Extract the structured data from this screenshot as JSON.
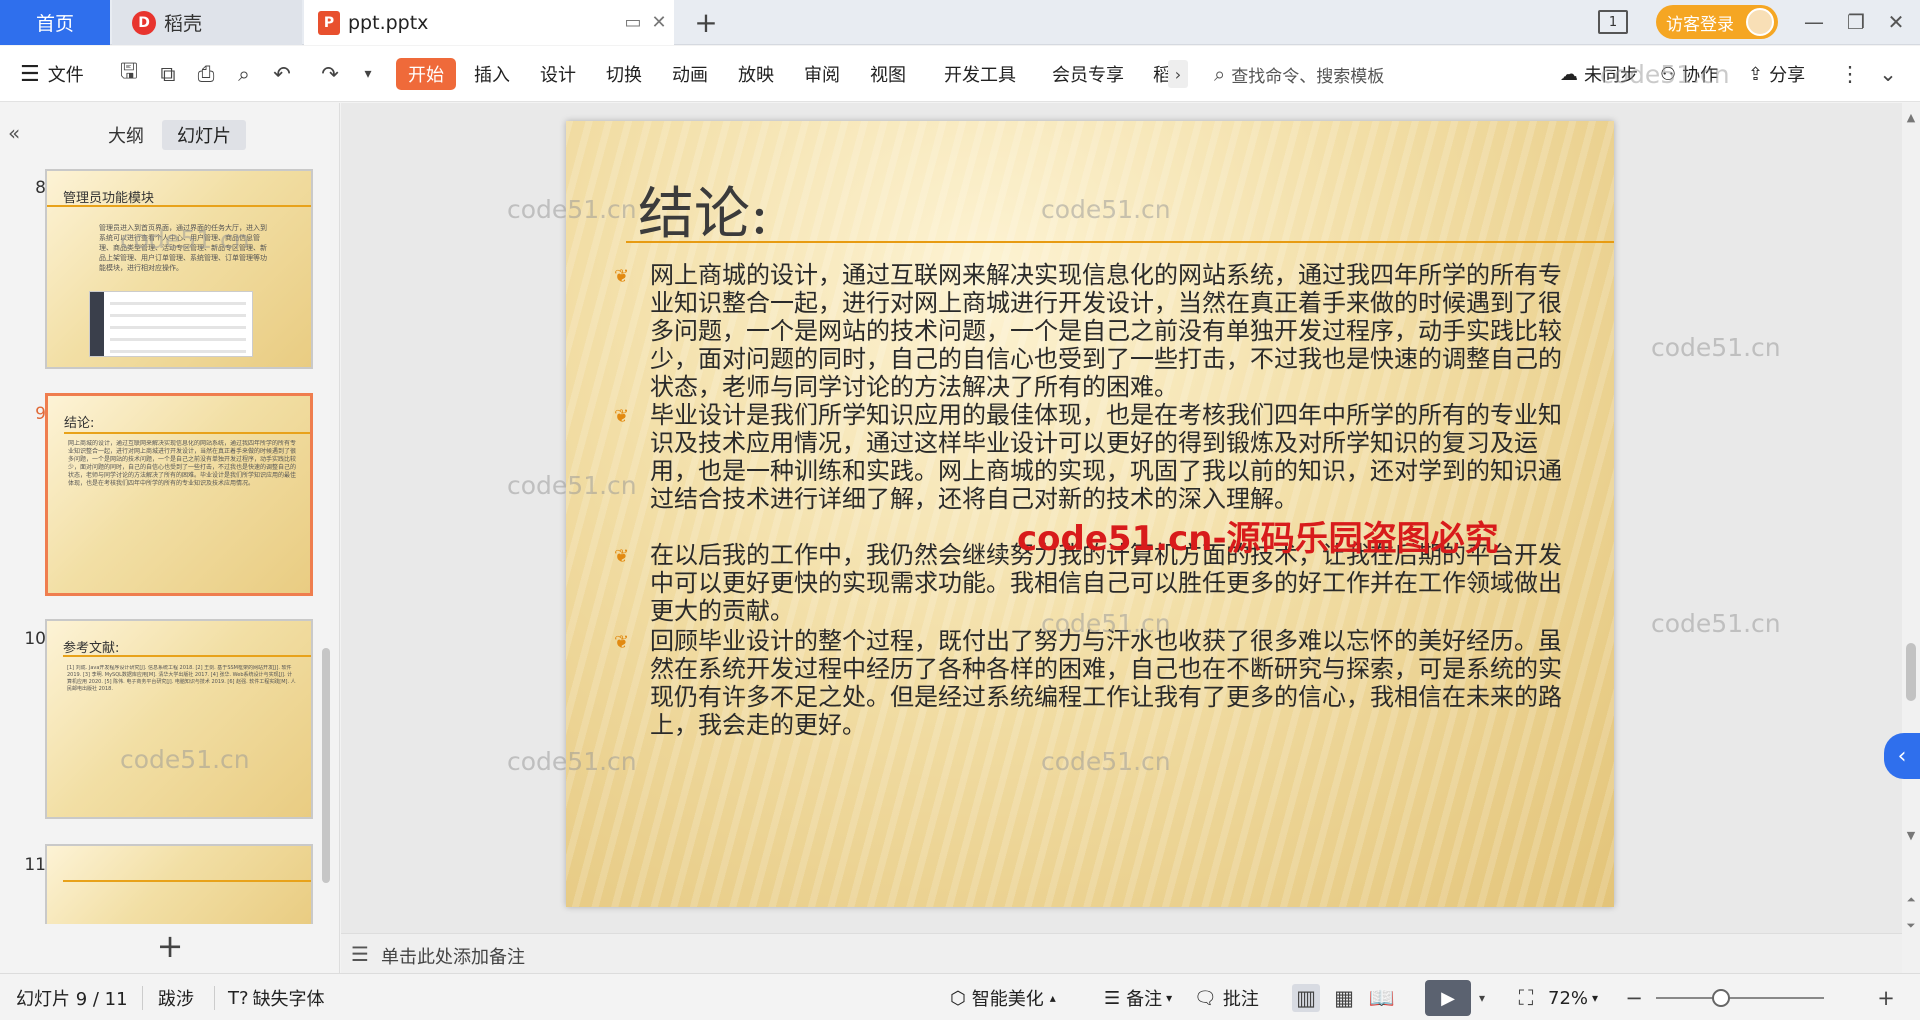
{
  "tabs": {
    "home": "首页",
    "daoke": "稻壳",
    "doc": "ppt.pptx",
    "new_tab": "+",
    "layout_badge": "1"
  },
  "account": {
    "visitor_login": "访客登录"
  },
  "ribbon": {
    "file": "文件",
    "menus": [
      "开始",
      "插入",
      "设计",
      "切换",
      "动画",
      "放映",
      "审阅",
      "视图",
      "开发工具",
      "会员专享",
      "稻"
    ],
    "search_placeholder": "查找命令、搜索模板",
    "sync": "未同步",
    "collab": "协作",
    "share": "分享"
  },
  "left_pane": {
    "tab_outline": "大纲",
    "tab_slides": "幻灯片",
    "add": "+",
    "thumbs": [
      {
        "num": "8",
        "title": "管理员功能模块",
        "text": "管理员进入到首页界面，通过界面的任务大厅，进入到系统可以进行查看个人中心、用户管理、商品信息管理、商品类型管理、活动专区管理、新品专区管理、新品上架管理、用户订单管理、系统管理、订单管理等功能模块，进行相对应操作。"
      },
      {
        "num": "9",
        "title": "结论:",
        "text": "网上商城的设计，通过互联网来解决实现信息化的网站系统，通过我四年所学的所有专业知识整合一起，进行对网上商城进行开发设计，当然在真正着手来做的时候遇到了很多问题，一个是网站的技术问题，一个是自己之前没有单独开发过程序，动手实践比较少，面对问题的同时，自己的自信心也受到了一些打击，不过我也是快速的调整自己的状态，老师与同学讨论的方法解决了所有的困难。毕业设计是我们所学知识应用的最佳体现，也是在考核我们四年中所学的所有的专业知识及技术应用情况。"
      },
      {
        "num": "10",
        "title": "参考文献:",
        "text": "[1] 刘成. Java开发程序设计研究[J]. 信息系统工程 2018. [2] 王剑. 基于SSM框架的网站开发[J]. 软件 2019. [3] 李明. MySQL数据库应用[M]. 清华大学出版社 2017. [4] 张华. Web系统设计与实现[J]. 计算机应用 2020. [5] 陈伟. 电子商务平台研究[J]. 电脑知识与技术 2019. [6] 赵强. 软件工程实践[M]. 人民邮电出版社 2018."
      },
      {
        "num": "11",
        "title": "",
        "text": ""
      }
    ]
  },
  "slide": {
    "title": "结论:",
    "bullets": [
      "网上商城的设计，通过互联网来解决实现信息化的网站系统，通过我四年所学的所有专业知识整合一起，进行对网上商城进行开发设计，当然在真正着手来做的时候遇到了很多问题，一个是网站的技术问题，一个是自己之前没有单独开发过程序，动手实践比较少，面对问题的同时，自己的自信心也受到了一些打击，不过我也是快速的调整自己的状态，老师与同学讨论的方法解决了所有的困难。",
      "毕业设计是我们所学知识应用的最佳体现，也是在考核我们四年中所学的所有的专业知识及技术应用情况，通过这样毕业设计可以更好的得到锻炼及对所学知识的复习及运用，也是一种训练和实践。网上商城的实现，巩固了我以前的知识，还对学到的知识通过结合技术进行详细了解，还将自己对新的技术的深入理解。",
      "在以后我的工作中，我仍然会继续努力我的计算机方面的技术，让我在后期的平台开发中可以更好更快的实现需求功能。我相信自己可以胜任更多的好工作并在工作领域做出更大的贡献。",
      "回顾毕业设计的整个过程，既付出了努力与汗水也收获了很多难以忘怀的美好经历。虽然在系统开发过程中经历了各种各样的困难，自己也在不断研究与探索，可是系统的实现仍有许多不足之处。但是经过系统编程工作让我有了更多的信心，我相信在未来的路上，我会走的更好。"
    ],
    "watermark_red": "code51.cn-源码乐园盗图必究",
    "watermark": "code51.cn"
  },
  "notes": {
    "placeholder": "单击此处添加备注"
  },
  "status": {
    "slide_counter": "幻灯片 9 / 11",
    "theme": "跋涉",
    "missing_font": "缺失字体",
    "beautify": "智能美化",
    "notes": "备注",
    "comments": "批注",
    "zoom": "72%"
  },
  "colors": {
    "accent": "#2f6fed",
    "start_tab": "#ef6a3a",
    "slide_rule": "#e79b12",
    "selected_thumb": "#ef7d4e",
    "watermark_red": "#d81b1b"
  }
}
